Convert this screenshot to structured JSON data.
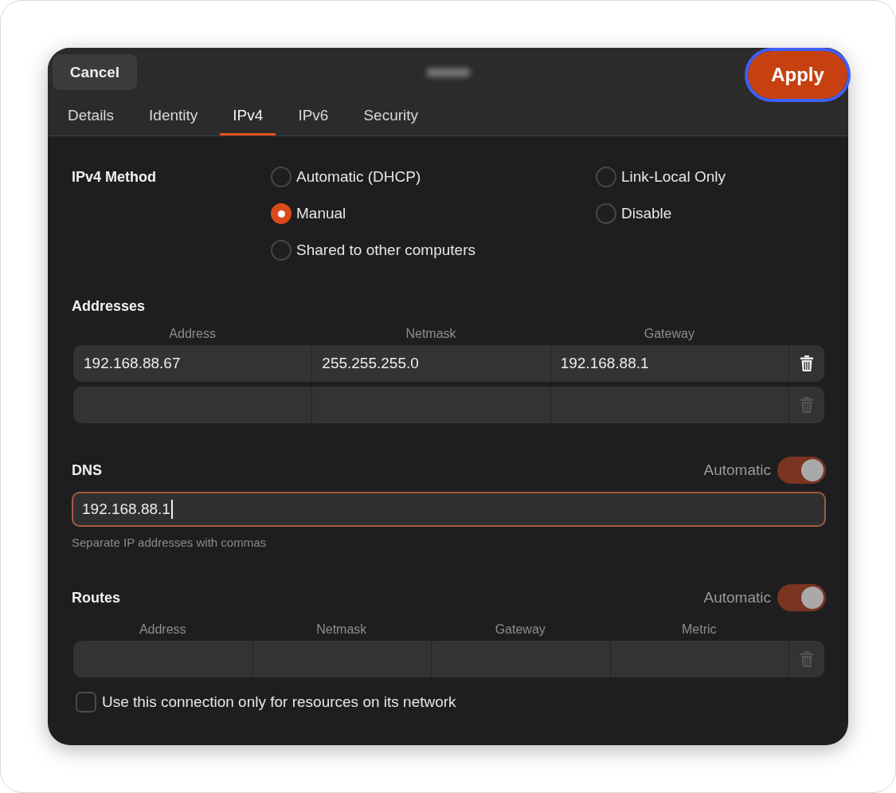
{
  "header": {
    "cancel": "Cancel",
    "apply": {
      "label": "Apply",
      "focused": true
    }
  },
  "tabs": [
    {
      "label": "Details",
      "selected": false
    },
    {
      "label": "Identity",
      "selected": false
    },
    {
      "label": "IPv4",
      "selected": true
    },
    {
      "label": "IPv6",
      "selected": false
    },
    {
      "label": "Security",
      "selected": false
    }
  ],
  "ipv4_method": {
    "label": "IPv4 Method",
    "options": [
      {
        "label": "Automatic (DHCP)",
        "selected": false
      },
      {
        "label": "Link-Local Only",
        "selected": false
      },
      {
        "label": "Manual",
        "selected": true
      },
      {
        "label": "Disable",
        "selected": false
      },
      {
        "label": "Shared to other computers",
        "selected": false
      }
    ]
  },
  "addresses": {
    "label": "Addresses",
    "columns": [
      "Address",
      "Netmask",
      "Gateway"
    ],
    "rows": [
      {
        "cells": [
          "192.168.88.67",
          "255.255.255.0",
          "192.168.88.1"
        ],
        "delete_disabled": false
      },
      {
        "delete_disabled": true
      }
    ]
  },
  "dns": {
    "label": "DNS",
    "automatic_label": "Automatic",
    "automatic": true,
    "value": "192.168.88.1",
    "focused": true,
    "hint": "Separate IP addresses with commas"
  },
  "routes": {
    "label": "Routes",
    "automatic_label": "Automatic",
    "automatic": true,
    "columns": [
      "Address",
      "Netmask",
      "Gateway",
      "Metric"
    ],
    "rows": [
      {
        "delete_disabled": true
      }
    ]
  },
  "network_only": {
    "label": "Use this connection only for resources on its network",
    "checked": false
  }
}
